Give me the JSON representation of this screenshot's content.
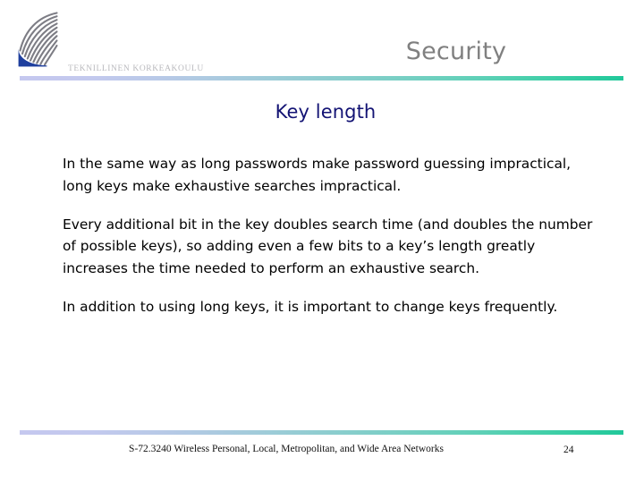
{
  "slide": {
    "title": "Security",
    "subtitle": "Key length",
    "paragraphs": [
      "In the same way as long passwords make password guessing impractical, long keys make exhaustive searches impractical.",
      "Every additional bit in the key doubles search time (and doubles the number of possible keys), so adding even a few bits to a key’s length greatly increases the time needed to perform an exhaustive search.",
      "In addition to using long keys, it is important to change keys frequently."
    ]
  },
  "branding": {
    "wordmark": "TEKNILLINEN KORKEAKOULU",
    "logo_icon": "tkk-leaf-logo-icon",
    "logo_gray": "#7d7d85",
    "logo_blue": "#1f3f9e"
  },
  "footer": {
    "course": "S-72.3240 Wireless Personal, Local, Metropolitan, and Wide Area Networks",
    "page_number": "24"
  },
  "theme": {
    "title_color": "#808080",
    "subtitle_color": "#131374",
    "body_color": "#000000",
    "rule_start_color": "#c5c8ef",
    "rule_end_color": "#21c89a",
    "background": "#ffffff"
  }
}
